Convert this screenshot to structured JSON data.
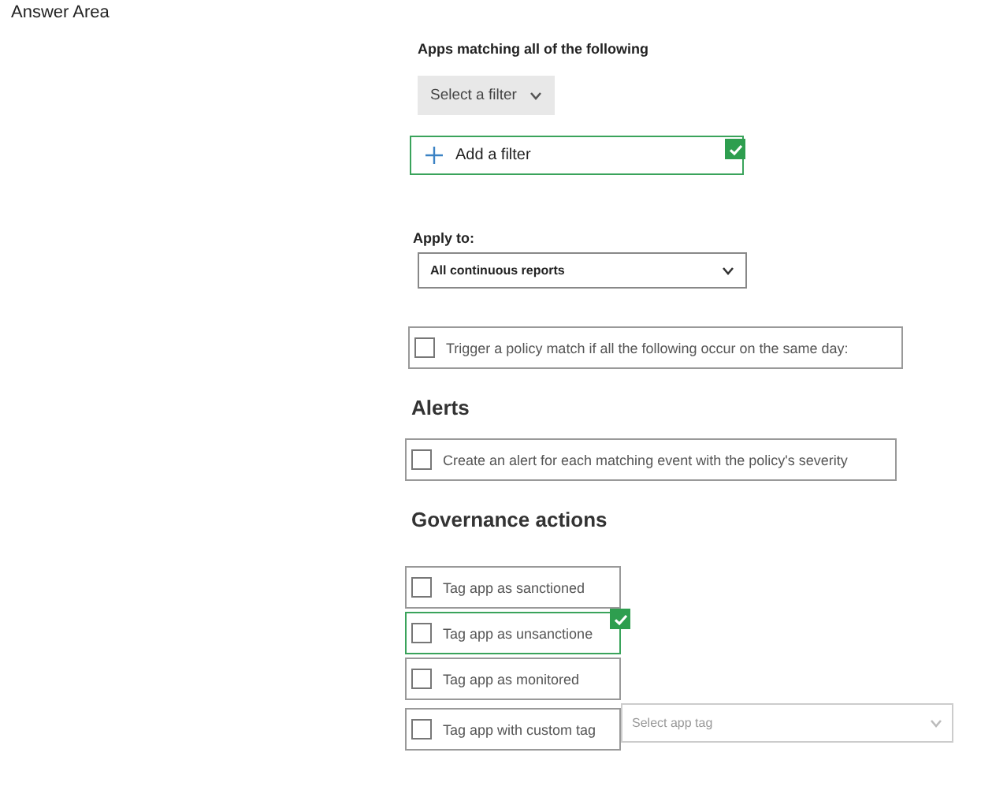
{
  "title": "Answer Area",
  "filters": {
    "heading": "Apps matching all of the following",
    "select": {
      "label": "Select a filter"
    },
    "add": {
      "label": "Add a filter",
      "marked": true
    }
  },
  "apply_to": {
    "label": "Apply to:",
    "value": "All continuous reports"
  },
  "trigger": {
    "label": "Trigger a policy match if all the following occur on the same day:",
    "checked": false
  },
  "alerts": {
    "heading": "Alerts",
    "items": [
      {
        "label": "Create an alert for each matching event with the policy's severity",
        "checked": false
      }
    ]
  },
  "governance": {
    "heading": "Governance actions",
    "items": [
      {
        "label": "Tag app as sanctioned",
        "checked": false,
        "marked": false
      },
      {
        "label": "Tag app as unsanctione",
        "checked": false,
        "marked": true
      },
      {
        "label": "Tag app as monitored",
        "checked": false,
        "marked": false
      },
      {
        "label": "Tag app with custom tag",
        "checked": false,
        "marked": false,
        "tag_select": {
          "placeholder": "Select app tag"
        }
      }
    ]
  }
}
